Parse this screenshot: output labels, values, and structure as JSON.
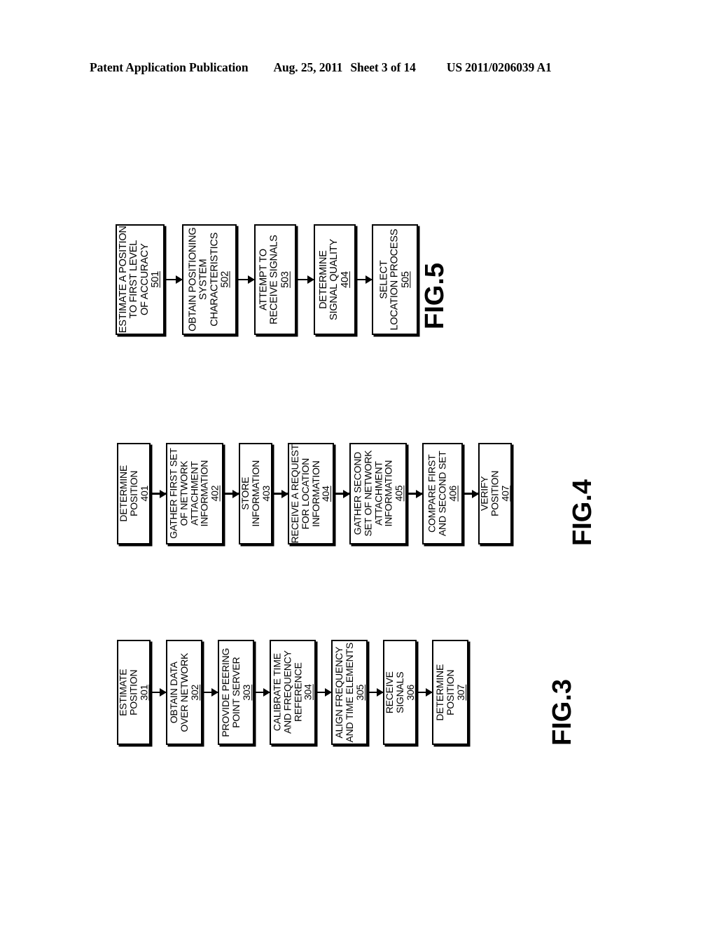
{
  "header": {
    "publication": "Patent Application Publication",
    "date": "Aug. 25, 2011",
    "sheet": "Sheet 3 of 14",
    "doc_number": "US 2011/0206039 A1"
  },
  "figures": [
    {
      "id": "fig-5",
      "caption": "FIG.5",
      "steps": [
        {
          "lines": [
            "ESTIMATE A POSITION",
            "TO FIRST LEVEL",
            "OF ACCURACY"
          ],
          "ref": "501"
        },
        {
          "lines": [
            "OBTAIN POSITIONING",
            "SYSTEM",
            "CHARACTERISTICS"
          ],
          "ref": "502"
        },
        {
          "lines": [
            "ATTEMPT TO",
            "RECEIVE SIGNALS"
          ],
          "ref": "503"
        },
        {
          "lines": [
            "DETERMINE",
            "SIGNAL QUALITY"
          ],
          "ref": "404"
        },
        {
          "lines": [
            "SELECT",
            "LOCATION PROCESS"
          ],
          "ref": "505"
        }
      ]
    },
    {
      "id": "fig-4",
      "caption": "FIG.4",
      "steps": [
        {
          "lines": [
            "DETERMINE",
            "POSITION"
          ],
          "ref": "401"
        },
        {
          "lines": [
            "GATHER FIRST SET",
            "OF NETWORK",
            "ATTACHMENT",
            "INFORMATION"
          ],
          "ref": "402"
        },
        {
          "lines": [
            "STORE",
            "INFORMATION"
          ],
          "ref": "403"
        },
        {
          "lines": [
            "RECEIVE A REQUEST",
            "FOR LOCATION",
            "INFORMATION"
          ],
          "ref": "404"
        },
        {
          "lines": [
            "GATHER SECOND",
            "SET OF NETWORK",
            "ATTACHMENT",
            "INFORMATION"
          ],
          "ref": "405"
        },
        {
          "lines": [
            "COMPARE FIRST",
            "AND SECOND SET"
          ],
          "ref": "406"
        },
        {
          "lines": [
            "VERIFY",
            "POSITION"
          ],
          "ref": "407"
        }
      ]
    },
    {
      "id": "fig-3",
      "caption": "FIG.3",
      "steps": [
        {
          "lines": [
            "ESTIMATE",
            "POSITION"
          ],
          "ref": "301"
        },
        {
          "lines": [
            "OBTAIN DATA",
            "OVER NETWORK"
          ],
          "ref": "302"
        },
        {
          "lines": [
            "PROVIDE PEERING",
            "POINT SERVER"
          ],
          "ref": "303"
        },
        {
          "lines": [
            "CALIBRATE TIME",
            "AND FREQUENCY",
            "REFERENCE"
          ],
          "ref": "304"
        },
        {
          "lines": [
            "ALIGN FREQUENCY",
            "AND TIME ELEMENTS"
          ],
          "ref": "305"
        },
        {
          "lines": [
            "RECEIVE",
            "SIGNALS"
          ],
          "ref": "306"
        },
        {
          "lines": [
            "DETERMINE",
            "POSITION"
          ],
          "ref": "307"
        }
      ]
    }
  ]
}
